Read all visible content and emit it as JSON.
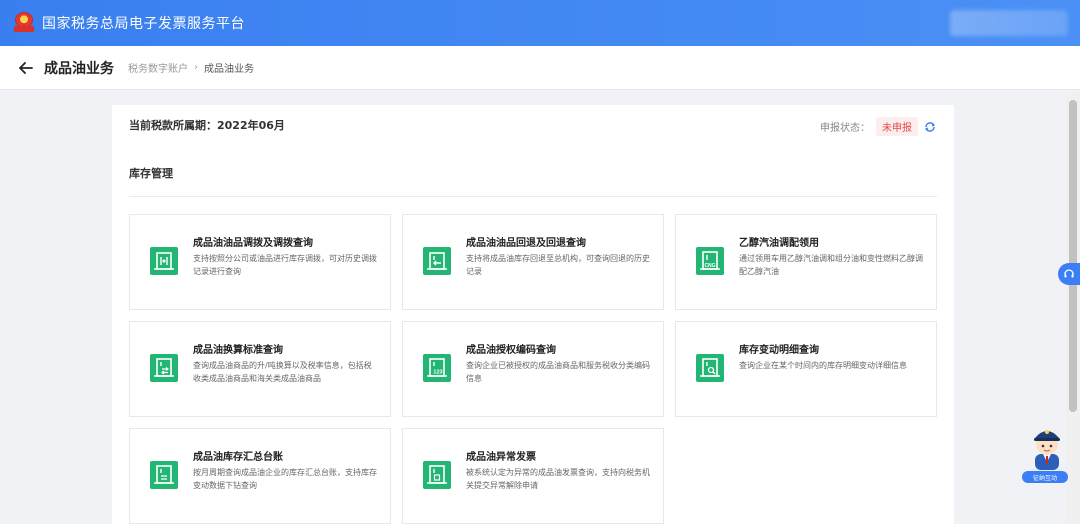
{
  "app": {
    "title": "国家税务总局电子发票服务平台"
  },
  "header": {
    "page_title": "成品油业务",
    "breadcrumb": [
      "税务数字账户",
      "成品油业务"
    ],
    "breadcrumb_sep": "›"
  },
  "panel": {
    "period": "当前税款所属期：2022年06月",
    "status_label": "申报状态：",
    "status_value": "未申报",
    "section_title": "库存管理"
  },
  "cards": [
    {
      "title": "成品油油品调拨及调拨查询",
      "desc": "支持按照分公司或油品进行库存调拨，可对历史调拨记录进行查询",
      "icon": "transfer-icon"
    },
    {
      "title": "成品油油品回退及回退查询",
      "desc": "支持将成品油库存回退至总机构，可查询回退的历史记录",
      "icon": "return-icon"
    },
    {
      "title": "乙醇汽油调配领用",
      "desc": "通过领用车用乙醇汽油调和组分油和变性燃料乙醇调配乙醇汽油",
      "icon": "ethanol-icon"
    },
    {
      "title": "成品油换算标准查询",
      "desc": "查询成品油商品的升/吨换算以及税率信息，包括税收类成品油商品和海关类成品油商品",
      "icon": "convert-icon"
    },
    {
      "title": "成品油授权编码查询",
      "desc": "查询企业已被授权的成品油商品和服务税收分类编码信息",
      "icon": "code-icon"
    },
    {
      "title": "库存变动明细查询",
      "desc": "查询企业在某个时间内的库存明细变动详细信息",
      "icon": "inventory-search-icon"
    },
    {
      "title": "成品油库存汇总台账",
      "desc": "按月周期查询成品油企业的库存汇总台账，支持库存变动数据下钻查询",
      "icon": "ledger-icon"
    },
    {
      "title": "成品油异常发票",
      "desc": "被系统认定为异常的成品油发票查询，支持向税务机关提交异常解除申请",
      "icon": "abnormal-invoice-icon"
    }
  ],
  "icon_glyphs": {
    "ethanol_tag": "CNG",
    "code_tag": "123"
  },
  "assistant": {
    "label": "征纳互动"
  },
  "colors": {
    "topbar": "#3a7ff0",
    "card_icon": "#23b574",
    "status_text": "#e24a4a",
    "status_bg": "#fdeeee"
  }
}
